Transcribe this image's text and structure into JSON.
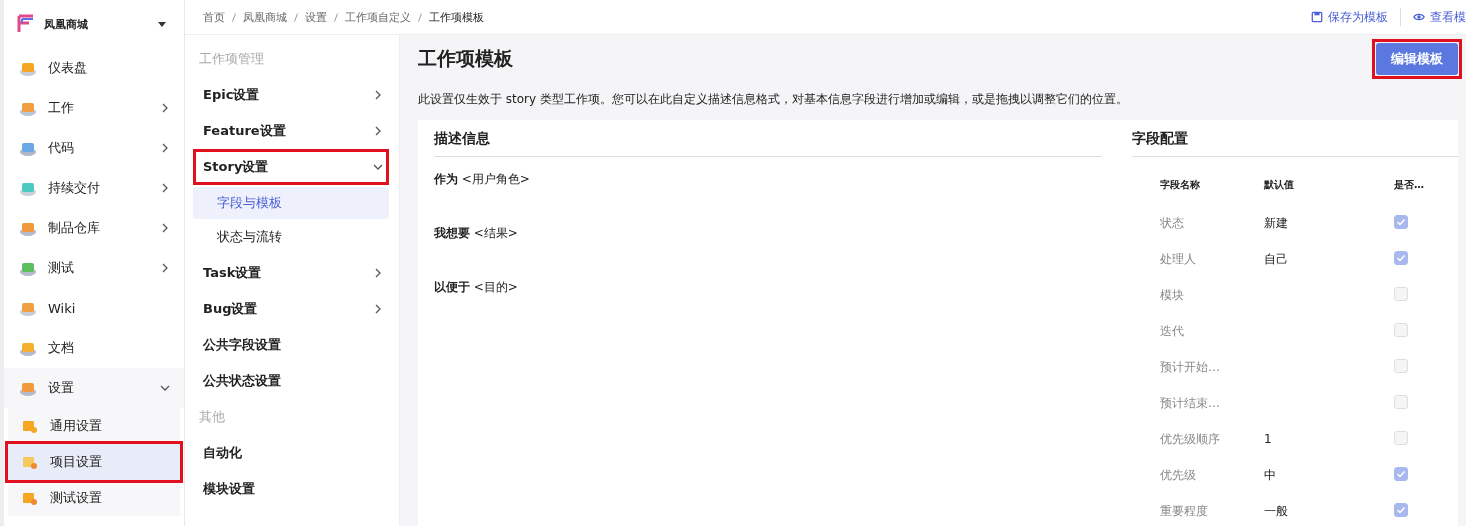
{
  "project": {
    "name": "凤凰商城"
  },
  "sidebar": {
    "items": [
      {
        "label": "仪表盘",
        "has_arrow": false
      },
      {
        "label": "工作",
        "has_arrow": true,
        "expanded": false
      },
      {
        "label": "代码",
        "has_arrow": true,
        "expanded": false
      },
      {
        "label": "持续交付",
        "has_arrow": true,
        "expanded": false
      },
      {
        "label": "制品仓库",
        "has_arrow": true,
        "expanded": false
      },
      {
        "label": "测试",
        "has_arrow": true,
        "expanded": false
      },
      {
        "label": "Wiki",
        "has_arrow": false
      },
      {
        "label": "文档",
        "has_arrow": false
      },
      {
        "label": "设置",
        "has_arrow": true,
        "expanded": true,
        "children": [
          {
            "label": "通用设置",
            "selected": false,
            "highlighted": false
          },
          {
            "label": "项目设置",
            "selected": true,
            "highlighted": true
          },
          {
            "label": "测试设置",
            "selected": false,
            "highlighted": false
          }
        ]
      }
    ]
  },
  "breadcrumb": [
    "首页",
    "凤凰商城",
    "设置",
    "工作项自定义",
    "工作项模板"
  ],
  "toolbar": [
    {
      "label": "保存为模板"
    },
    {
      "label": "查看模"
    }
  ],
  "settings_nav": [
    {
      "kind": "heading",
      "label": "工作项管理"
    },
    {
      "kind": "group",
      "label": "Epic设置",
      "expanded": false,
      "highlighted": false
    },
    {
      "kind": "group",
      "label": "Feature设置",
      "expanded": false,
      "highlighted": false
    },
    {
      "kind": "group",
      "label": "Story设置",
      "expanded": true,
      "highlighted": true
    },
    {
      "kind": "sub",
      "label": "字段与模板",
      "selected": true
    },
    {
      "kind": "sub",
      "label": "状态与流转",
      "selected": false
    },
    {
      "kind": "group",
      "label": "Task设置",
      "expanded": false,
      "highlighted": false
    },
    {
      "kind": "group",
      "label": "Bug设置",
      "expanded": false,
      "highlighted": false
    },
    {
      "kind": "link",
      "label": "公共字段设置"
    },
    {
      "kind": "link",
      "label": "公共状态设置"
    },
    {
      "kind": "heading",
      "label": "其他"
    },
    {
      "kind": "link",
      "label": "自动化"
    },
    {
      "kind": "link",
      "label": "模块设置"
    }
  ],
  "page": {
    "title": "工作项模板",
    "edit_button": {
      "label": "编辑模板",
      "highlighted": true
    },
    "description": "此设置仅生效于 story 类型工作项。您可以在此自定义描述信息格式，对基本信息字段进行增加或编辑，或是拖拽以调整它们的位置。"
  },
  "description_card": {
    "title": "描述信息",
    "lines": [
      {
        "label": "作为",
        "placeholder_text": "<用户角色>"
      },
      {
        "label": "我想要",
        "placeholder_text": "<结果>"
      },
      {
        "label": "以便于",
        "placeholder_text": "<目的>"
      }
    ]
  },
  "field_config": {
    "title": "字段配置",
    "columns": [
      "字段名称",
      "默认值",
      "是否…"
    ],
    "rows": [
      {
        "name": "状态",
        "default": "新建",
        "checked": true
      },
      {
        "name": "处理人",
        "default": "自己",
        "checked": true
      },
      {
        "name": "模块",
        "checked": false
      },
      {
        "name": "迭代",
        "checked": false
      },
      {
        "name": "预计开始…",
        "checked": false
      },
      {
        "name": "预计结束…",
        "checked": false
      },
      {
        "name": "优先级顺序",
        "default": "1",
        "checked": false
      },
      {
        "name": "优先级",
        "default": "中",
        "checked": true
      },
      {
        "name": "重要程度",
        "default": "一般",
        "checked": true
      }
    ]
  }
}
